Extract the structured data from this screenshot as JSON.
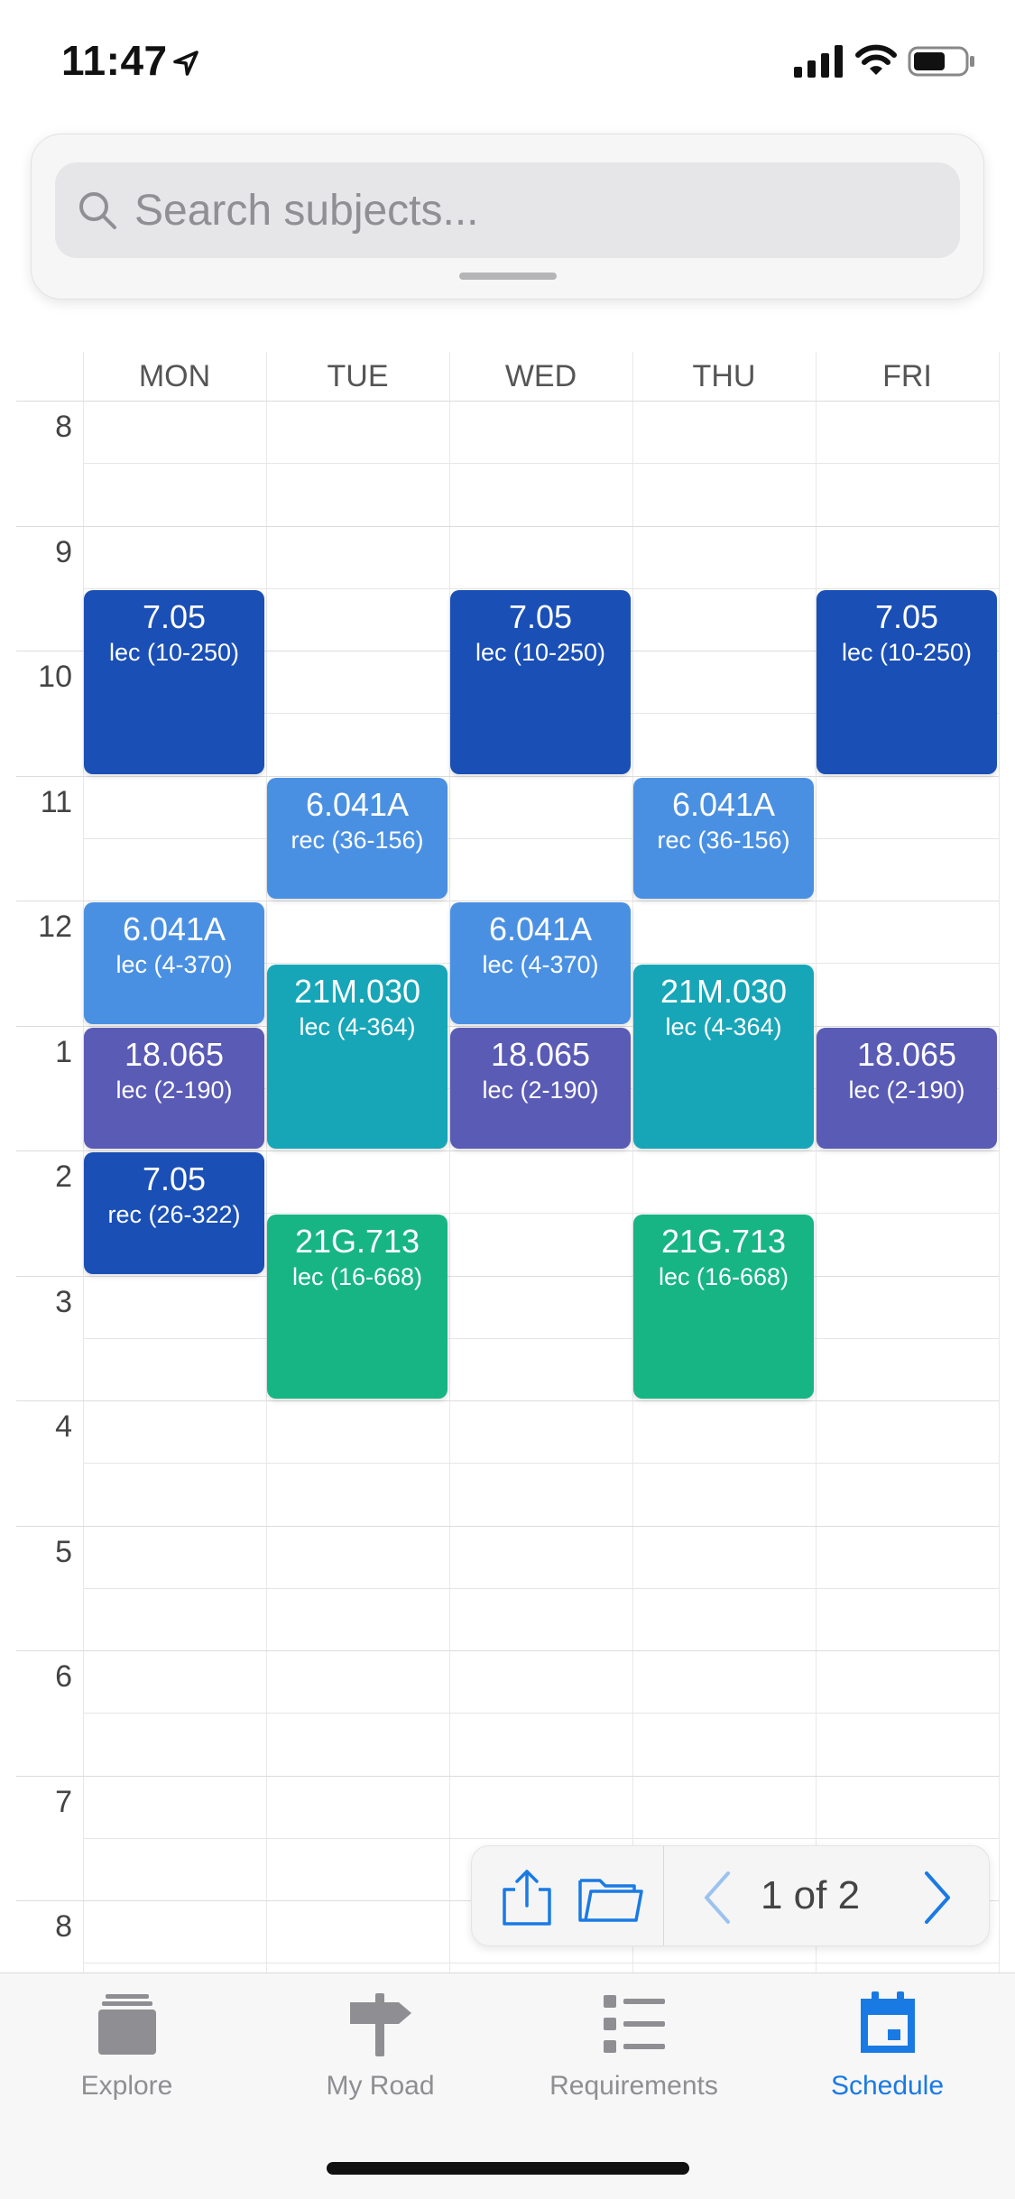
{
  "status_bar": {
    "time": "11:47"
  },
  "search": {
    "placeholder": "Search subjects..."
  },
  "schedule": {
    "days": [
      "MON",
      "TUE",
      "WED",
      "THU",
      "FRI"
    ],
    "hours": [
      "8",
      "9",
      "10",
      "11",
      "12",
      "1",
      "2",
      "3",
      "4",
      "5",
      "6",
      "7",
      "8"
    ],
    "colors": {
      "7.05": "#1a4fb5",
      "6.041A": "#4a90e2",
      "18.065": "#5a5bb5",
      "21M.030": "#17a6b8",
      "21G.713": "#17b584"
    },
    "events": [
      {
        "day": 0,
        "start": 9.5,
        "end": 11,
        "subject": "7.05",
        "location": "lec (10-250)"
      },
      {
        "day": 2,
        "start": 9.5,
        "end": 11,
        "subject": "7.05",
        "location": "lec (10-250)"
      },
      {
        "day": 4,
        "start": 9.5,
        "end": 11,
        "subject": "7.05",
        "location": "lec (10-250)"
      },
      {
        "day": 1,
        "start": 11,
        "end": 12,
        "subject": "6.041A",
        "location": "rec (36-156)"
      },
      {
        "day": 3,
        "start": 11,
        "end": 12,
        "subject": "6.041A",
        "location": "rec (36-156)"
      },
      {
        "day": 0,
        "start": 12,
        "end": 13,
        "subject": "6.041A",
        "location": "lec (4-370)"
      },
      {
        "day": 2,
        "start": 12,
        "end": 13,
        "subject": "6.041A",
        "location": "lec (4-370)"
      },
      {
        "day": 1,
        "start": 12.5,
        "end": 14,
        "subject": "21M.030",
        "location": "lec (4-364)"
      },
      {
        "day": 3,
        "start": 12.5,
        "end": 14,
        "subject": "21M.030",
        "location": "lec (4-364)"
      },
      {
        "day": 0,
        "start": 13,
        "end": 14,
        "subject": "18.065",
        "location": "lec (2-190)"
      },
      {
        "day": 2,
        "start": 13,
        "end": 14,
        "subject": "18.065",
        "location": "lec (2-190)"
      },
      {
        "day": 4,
        "start": 13,
        "end": 14,
        "subject": "18.065",
        "location": "lec (2-190)"
      },
      {
        "day": 0,
        "start": 14,
        "end": 15,
        "subject": "7.05",
        "location": "rec (26-322)"
      },
      {
        "day": 1,
        "start": 14.5,
        "end": 16,
        "subject": "21G.713",
        "location": "lec (16-668)"
      },
      {
        "day": 3,
        "start": 14.5,
        "end": 16,
        "subject": "21G.713",
        "location": "lec (16-668)"
      }
    ]
  },
  "toolbar": {
    "page_label": "1 of 2"
  },
  "tabbar": {
    "accent": "#1a7ae3",
    "inactive": "#8e8e93",
    "tabs": [
      {
        "label": "Explore",
        "icon": "stack-icon",
        "active": false
      },
      {
        "label": "My Road",
        "icon": "signpost-icon",
        "active": false
      },
      {
        "label": "Requirements",
        "icon": "list-icon",
        "active": false
      },
      {
        "label": "Schedule",
        "icon": "calendar-icon",
        "active": true
      }
    ]
  }
}
